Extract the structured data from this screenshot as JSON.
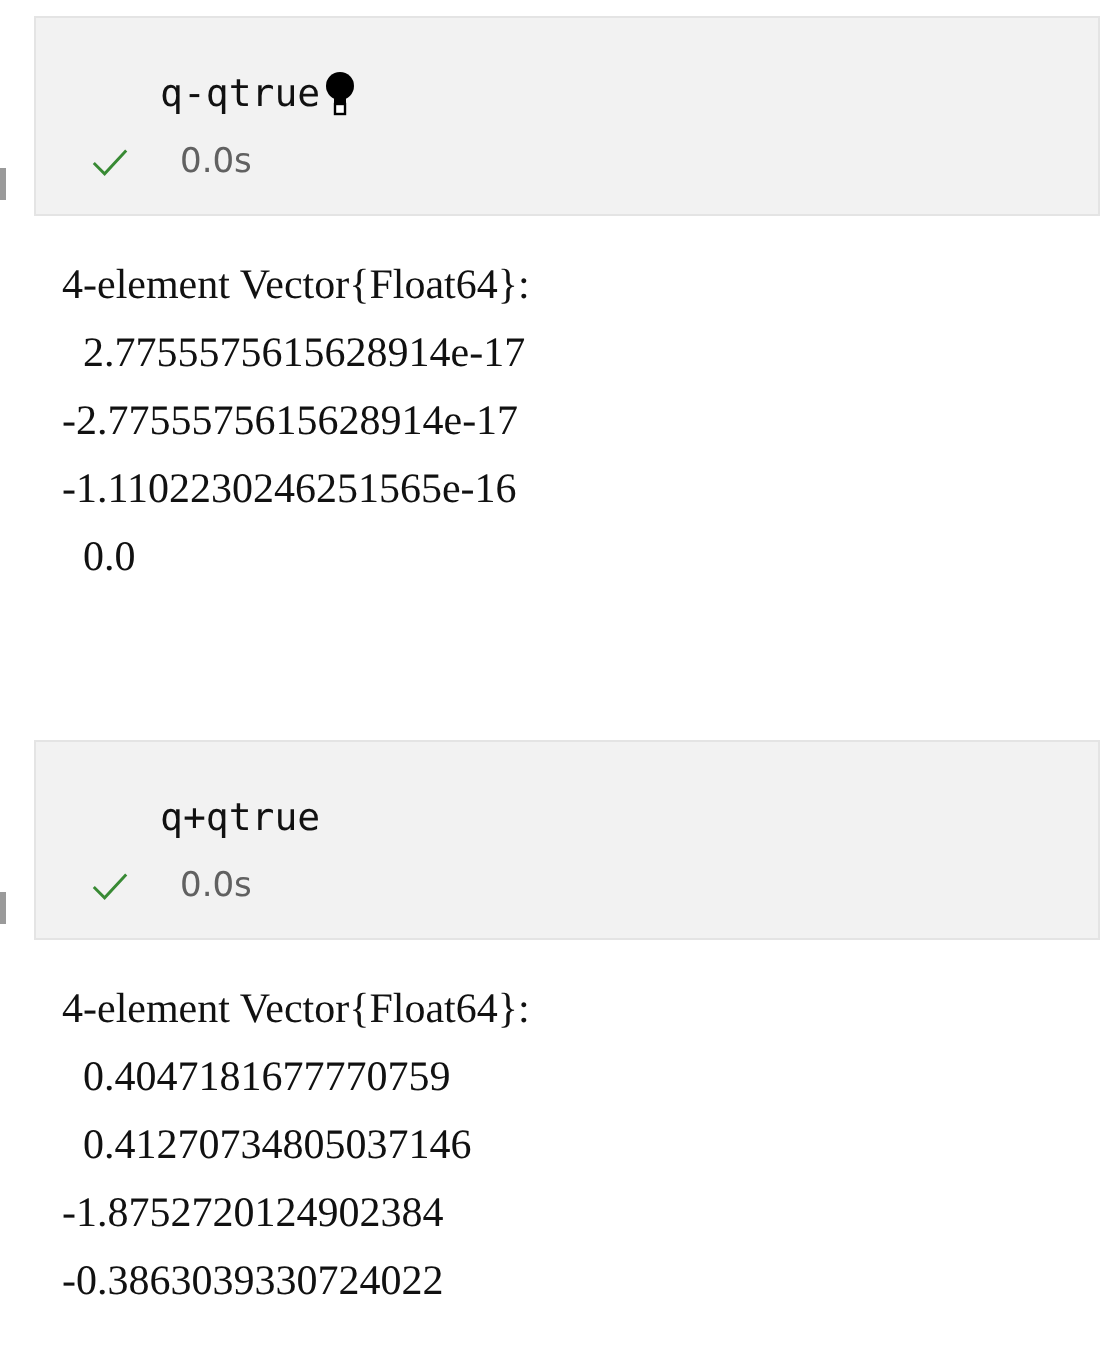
{
  "cells": [
    {
      "code": "q-qtrue",
      "hint_icon": true,
      "success": true,
      "duration": "0.0s",
      "output": [
        "4-element Vector{Float64}:",
        "  2.7755575615628914e-17",
        "-2.7755575615628914e-17",
        "-1.1102230246251565e-16",
        "  0.0"
      ]
    },
    {
      "code": "q+qtrue",
      "hint_icon": false,
      "success": true,
      "duration": "0.0s",
      "output": [
        "4-element Vector{Float64}:",
        "  0.4047181677770759",
        "  0.41270734805037146",
        "-1.8752720124902384",
        "-0.3863039330724022"
      ]
    }
  ]
}
